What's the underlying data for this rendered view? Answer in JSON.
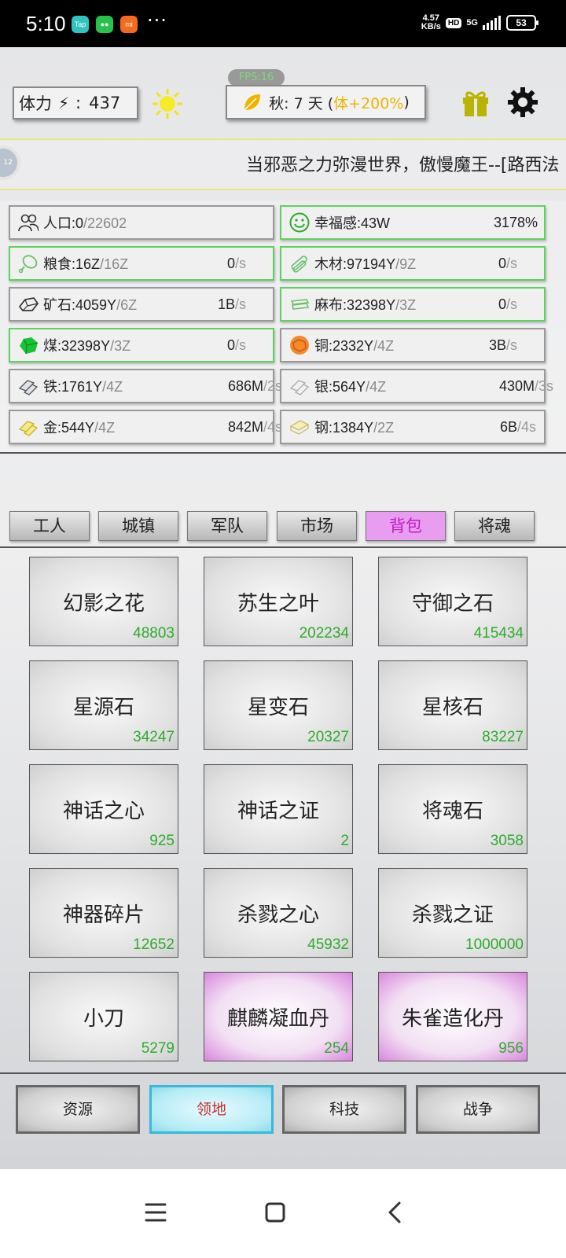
{
  "status_bar": {
    "time": "5:10",
    "apps": [
      "TapTap",
      "WeChat",
      "Xiaomi"
    ],
    "dots": "···",
    "net_speed_value": "4.57",
    "net_speed_unit": "KB/s",
    "hd": "HD",
    "network": "5G",
    "battery": "53"
  },
  "header": {
    "stamina_label": "体力",
    "stamina_sep": ":",
    "stamina_value": "437",
    "fps": "FPS:16",
    "season_text": "秋: 7 天 (",
    "season_bonus": "体+200%",
    "season_close": ")"
  },
  "marquee": {
    "avatar_text": "12",
    "text": "当邪恶之力弥漫世界，傲慢魔王--[路西法"
  },
  "resources": [
    {
      "name": "人口",
      "value": "0",
      "cap": "22602",
      "rate": null,
      "icon": "people-icon",
      "highlight": false
    },
    {
      "name": "幸福感",
      "value": "43W",
      "cap": null,
      "rate": "3178%",
      "icon": "smile-icon",
      "highlight": true
    },
    {
      "name": "粮食",
      "value": "16Z",
      "cap": "16Z",
      "rate": "0",
      "icon": "meat-icon",
      "highlight": true
    },
    {
      "name": "木材",
      "value": "97194Y",
      "cap": "9Z",
      "rate": "0",
      "icon": "wood-icon",
      "highlight": true
    },
    {
      "name": "矿石",
      "value": "4059Y",
      "cap": "6Z",
      "rate": "1B",
      "icon": "ore-icon",
      "highlight": false
    },
    {
      "name": "麻布",
      "value": "32398Y",
      "cap": "3Z",
      "rate": "0",
      "icon": "cloth-icon",
      "highlight": true
    },
    {
      "name": "煤",
      "value": "32398Y",
      "cap": "3Z",
      "rate": "0",
      "icon": "coal-icon",
      "highlight": true
    },
    {
      "name": "铜",
      "value": "2332Y",
      "cap": "4Z",
      "rate": "3B",
      "icon": "copper-icon",
      "highlight": false
    },
    {
      "name": "铁",
      "value": "1761Y",
      "cap": "4Z",
      "rate": "686M",
      "rate_unit": "/2s",
      "icon": "iron-icon",
      "highlight": false
    },
    {
      "name": "银",
      "value": "564Y",
      "cap": "4Z",
      "rate": "430M",
      "rate_unit": "/3s",
      "icon": "silver-icon",
      "highlight": false
    },
    {
      "name": "金",
      "value": "544Y",
      "cap": "4Z",
      "rate": "842M",
      "rate_unit": "/4s",
      "icon": "gold-icon",
      "highlight": false
    },
    {
      "name": "钢",
      "value": "1384Y",
      "cap": "2Z",
      "rate": "6B",
      "rate_unit": "/4s",
      "icon": "steel-icon",
      "highlight": false
    }
  ],
  "tabs": [
    "工人",
    "城镇",
    "军队",
    "市场",
    "背包",
    "将魂"
  ],
  "active_tab": "背包",
  "items": [
    {
      "name": "幻影之花",
      "count": "48803",
      "rare": false
    },
    {
      "name": "苏生之叶",
      "count": "202234",
      "rare": false
    },
    {
      "name": "守御之石",
      "count": "415434",
      "rare": false
    },
    {
      "name": "星源石",
      "count": "34247",
      "rare": false
    },
    {
      "name": "星变石",
      "count": "20327",
      "rare": false
    },
    {
      "name": "星核石",
      "count": "83227",
      "rare": false
    },
    {
      "name": "神话之心",
      "count": "925",
      "rare": false
    },
    {
      "name": "神话之证",
      "count": "2",
      "rare": false
    },
    {
      "name": "将魂石",
      "count": "3058",
      "rare": false
    },
    {
      "name": "神器碎片",
      "count": "12652",
      "rare": false
    },
    {
      "name": "杀戮之心",
      "count": "45932",
      "rare": false
    },
    {
      "name": "杀戮之证",
      "count": "1000000",
      "rare": false
    },
    {
      "name": "小刀",
      "count": "5279",
      "rare": false
    },
    {
      "name": "麒麟凝血丹",
      "count": "254",
      "rare": true
    },
    {
      "name": "朱雀造化丹",
      "count": "956",
      "rare": true
    }
  ],
  "bottom_nav": [
    "资源",
    "领地",
    "科技",
    "战争"
  ],
  "active_nav": "领地",
  "colors": {
    "accent_green": "#2faa2f",
    "tab_active": "#e89df0",
    "nav_active": "#39b8d8",
    "bonus": "#f0b400"
  }
}
